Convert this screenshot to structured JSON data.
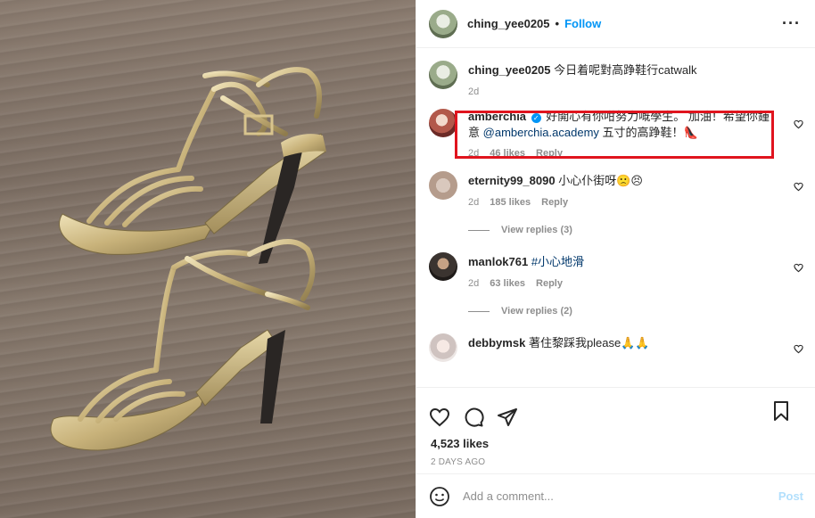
{
  "header": {
    "username": "ching_yee0205",
    "separator": "•",
    "follow_label": "Follow",
    "more_label": "···"
  },
  "caption": {
    "username": "ching_yee0205",
    "text": "今日着呢對高踭鞋行catwalk",
    "time": "2d"
  },
  "comments": [
    {
      "username": "amberchia",
      "verified": true,
      "text_before": "好開心有你咁努力嘅學生。 加油！希望你鍾意",
      "mention": "@amberchia.academy",
      "text_after": " 五寸的高踭鞋！👠",
      "time": "2d",
      "likes": "46 likes",
      "reply": "Reply"
    },
    {
      "username": "eternity99_8090",
      "text": "小心仆街呀🙁😣",
      "time": "2d",
      "likes": "185 likes",
      "reply": "Reply",
      "view_replies": "View replies (3)"
    },
    {
      "username": "manlok761",
      "hashtag": "#小心地滑",
      "time": "2d",
      "likes": "63 likes",
      "reply": "Reply",
      "view_replies": "View replies (2)"
    },
    {
      "username": "debbymsk",
      "text": "著住黎踩我please🙏🙏"
    }
  ],
  "post_actions": {
    "likes": "4,523 likes",
    "time": "2 DAYS AGO"
  },
  "add_comment": {
    "placeholder": "Add a comment...",
    "post_label": "Post"
  },
  "icons": {
    "like": "heart-icon",
    "comment": "comment-icon",
    "share": "share-icon",
    "save": "bookmark-icon",
    "emoji": "emoji-icon",
    "more": "more-icon"
  },
  "colors": {
    "link": "#0095f6",
    "highlight": "#e0141e",
    "muted": "#8e8e8e"
  }
}
